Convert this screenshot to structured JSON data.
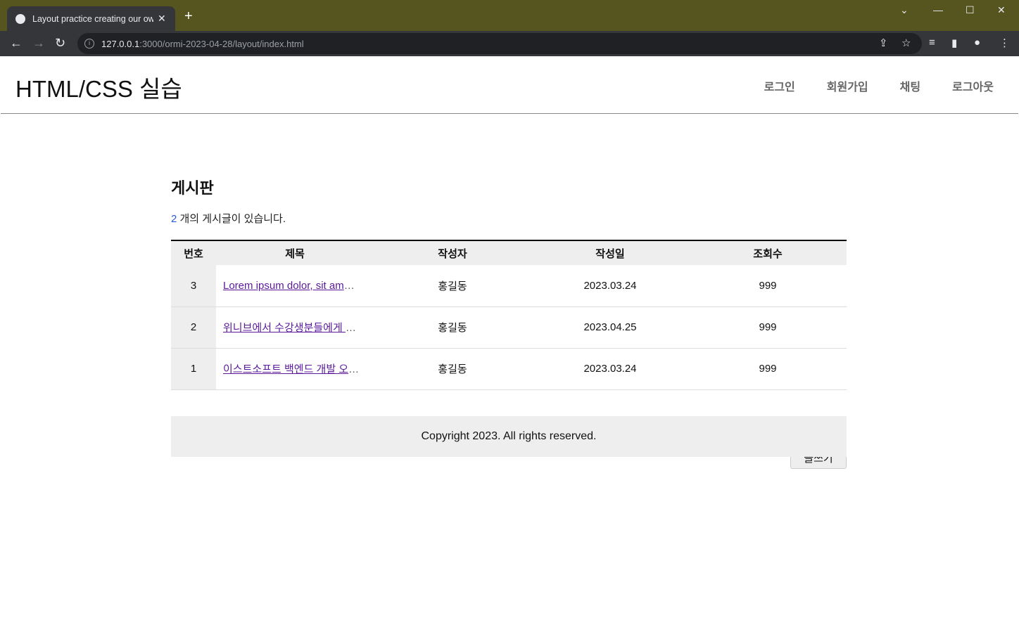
{
  "browser": {
    "tab_title": "Layout practice creating our own",
    "url_host": "127.0.0.1",
    "url_rest": ":3000/ormi-2023-04-28/layout/index.html"
  },
  "site": {
    "logo": "HTML/CSS 실습",
    "nav": [
      "로그인",
      "회원가입",
      "채팅",
      "로그아웃"
    ]
  },
  "board": {
    "title": "게시판",
    "count": "2",
    "count_text": " 개의 게시글이 있습니다.",
    "headers": [
      "번호",
      "제목",
      "작성자",
      "작성일",
      "조회수"
    ],
    "rows": [
      {
        "num": "3",
        "title": "Lorem ipsum dolor, sit am",
        "author": "홍길동",
        "date": "2023.03.24",
        "views": "999"
      },
      {
        "num": "2",
        "title": "위니브에서 수강생분들에게 ",
        "author": "홍길동",
        "date": "2023.04.25",
        "views": "999"
      },
      {
        "num": "1",
        "title": "이스트소프트 백엔드 개발 오",
        "author": "홍길동",
        "date": "2023.03.24",
        "views": "999"
      }
    ],
    "write_label": "글쓰기"
  },
  "footer": {
    "text": "Copyright 2023. All rights reserved."
  }
}
